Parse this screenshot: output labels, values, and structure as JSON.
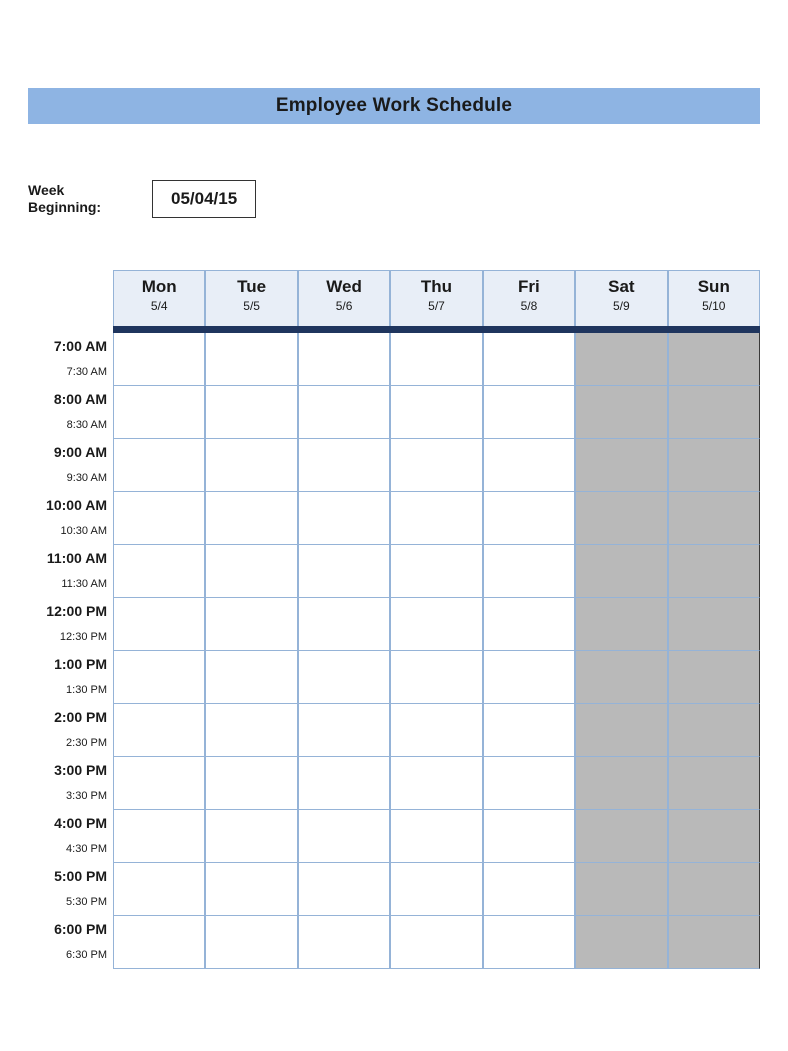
{
  "title": "Employee Work Schedule",
  "week_label_line1": "Week",
  "week_label_line2": "Beginning:",
  "week_beginning": "05/04/15",
  "days": [
    {
      "name": "Mon",
      "date": "5/4",
      "weekend": false
    },
    {
      "name": "Tue",
      "date": "5/5",
      "weekend": false
    },
    {
      "name": "Wed",
      "date": "5/6",
      "weekend": false
    },
    {
      "name": "Thu",
      "date": "5/7",
      "weekend": false
    },
    {
      "name": "Fri",
      "date": "5/8",
      "weekend": false
    },
    {
      "name": "Sat",
      "date": "5/9",
      "weekend": true
    },
    {
      "name": "Sun",
      "date": "5/10",
      "weekend": true
    }
  ],
  "times": [
    {
      "label": "7:00 AM",
      "major": true
    },
    {
      "label": "7:30 AM",
      "major": false
    },
    {
      "label": "8:00 AM",
      "major": true
    },
    {
      "label": "8:30 AM",
      "major": false
    },
    {
      "label": "9:00 AM",
      "major": true
    },
    {
      "label": "9:30 AM",
      "major": false
    },
    {
      "label": "10:00 AM",
      "major": true
    },
    {
      "label": "10:30 AM",
      "major": false
    },
    {
      "label": "11:00 AM",
      "major": true
    },
    {
      "label": "11:30 AM",
      "major": false
    },
    {
      "label": "12:00 PM",
      "major": true
    },
    {
      "label": "12:30 PM",
      "major": false
    },
    {
      "label": "1:00 PM",
      "major": true
    },
    {
      "label": "1:30 PM",
      "major": false
    },
    {
      "label": "2:00 PM",
      "major": true
    },
    {
      "label": "2:30 PM",
      "major": false
    },
    {
      "label": "3:00 PM",
      "major": true
    },
    {
      "label": "3:30 PM",
      "major": false
    },
    {
      "label": "4:00 PM",
      "major": true
    },
    {
      "label": "4:30 PM",
      "major": false
    },
    {
      "label": "5:00 PM",
      "major": true
    },
    {
      "label": "5:30 PM",
      "major": false
    },
    {
      "label": "6:00 PM",
      "major": true
    },
    {
      "label": "6:30 PM",
      "major": false
    }
  ]
}
